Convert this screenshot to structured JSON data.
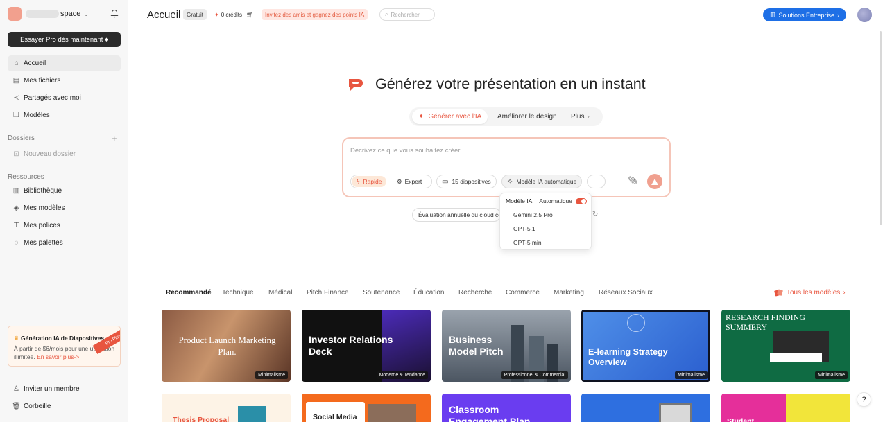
{
  "sidebar": {
    "workspace_name": "space",
    "pro_button": "Essayer Pro dès maintenant ♦",
    "nav": [
      {
        "label": "Accueil"
      },
      {
        "label": "Mes fichiers"
      },
      {
        "label": "Partagés avec moi"
      },
      {
        "label": "Modèles"
      }
    ],
    "folders_label": "Dossiers",
    "new_folder": "Nouveau dossier",
    "resources_label": "Ressources",
    "resources": [
      {
        "label": "Bibliothèque"
      },
      {
        "label": "Mes modèles"
      },
      {
        "label": "Mes polices"
      },
      {
        "label": "Mes palettes"
      }
    ],
    "promo": {
      "title": "Génération IA de Diapositives",
      "text": "À partir de $6/mois pour une utilisation illimitée.",
      "link": "En savoir plus->",
      "ribbon": "Pro Plus"
    },
    "invite": "Inviter un membre",
    "trash": "Corbeille"
  },
  "topbar": {
    "title": "Accueil",
    "plan": "Gratuit",
    "credits": "0 crédits",
    "invite": "Invitez des amis et gagnez des points IA",
    "search_placeholder": "Rechercher",
    "enterprise": "Solutions Entreprise"
  },
  "hero": {
    "title": "Générez votre présentation en un instant",
    "tabs": [
      "Générer avec l'IA",
      "Améliorer le design",
      "Plus"
    ],
    "placeholder": "Décrivez ce que vous souhaitez créer...",
    "mode_rapide": "Rapide",
    "mode_expert": "Expert",
    "slides": "15 diapositives",
    "model": "Modèle IA automatique",
    "more": "···",
    "suggestion": "Évaluation annuelle du cloud co"
  },
  "model_dropdown": {
    "header": "Modèle IA",
    "auto_label": "Automatique",
    "auto_on": true,
    "options": [
      "Gemini 2.5 Pro",
      "GPT-5.1",
      "GPT-5 mini"
    ]
  },
  "categories": [
    "Recommandé",
    "Technique",
    "Médical",
    "Pitch Finance",
    "Soutenance",
    "Éducation",
    "Recherche",
    "Commerce",
    "Marketing",
    "Réseaux Sociaux"
  ],
  "all_models": "Tous les modèles",
  "templates_row1": [
    {
      "title": "Product Launch Marketing Plan.",
      "badge": "Minimalisme"
    },
    {
      "title": "Investor Relations Deck",
      "badge": "Moderne & Tendance"
    },
    {
      "title": "Business Model Pitch",
      "badge": "Professionnel & Commercial"
    },
    {
      "title": "E-learning Strategy Overview",
      "badge": "Minimalisme"
    },
    {
      "title": "RESEARCH FINDING SUMMERY",
      "badge": "Minimalisme"
    }
  ],
  "templates_row2": [
    {
      "title": "Thesis Proposal"
    },
    {
      "title": "Social Media"
    },
    {
      "title": "Classroom Engagement Plan"
    },
    {
      "title": ""
    },
    {
      "title": "Student"
    }
  ],
  "help": "?"
}
